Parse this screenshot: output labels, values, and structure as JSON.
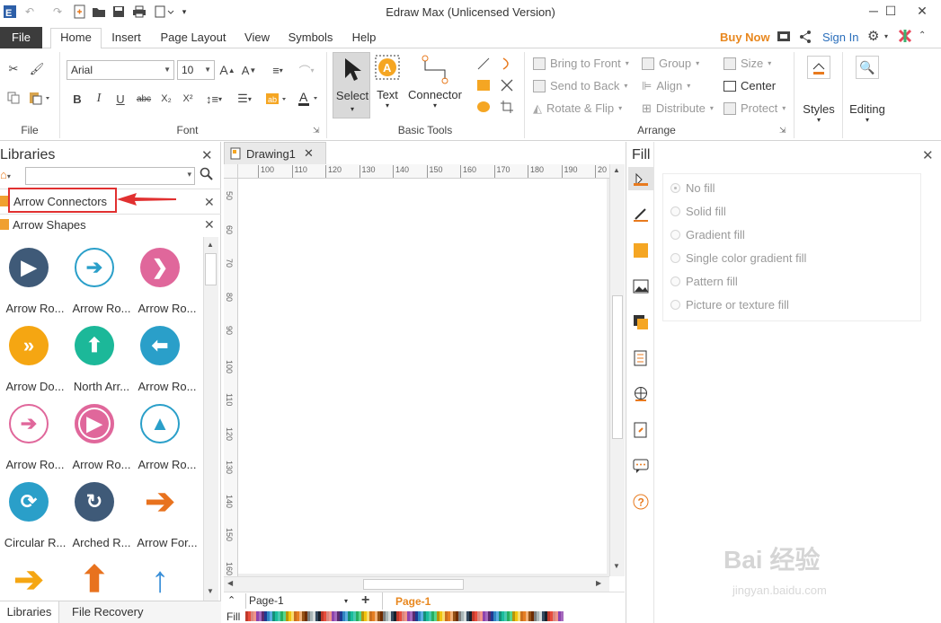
{
  "window": {
    "title": "Edraw Max (Unlicensed Version)",
    "minimize": "─",
    "maximize": "☐",
    "close": "✕"
  },
  "menu": {
    "tabs": [
      "File",
      "Home",
      "Insert",
      "Page Layout",
      "View",
      "Symbols",
      "Help"
    ],
    "buy_now": "Buy Now",
    "sign_in": "Sign In"
  },
  "ribbon": {
    "groups": {
      "file": "File",
      "font": "Font",
      "basic_tools": "Basic Tools",
      "arrange": "Arrange"
    },
    "font_name": "Arial",
    "font_size": "10",
    "select_label": "Select",
    "text_label": "Text",
    "connector_label": "Connector",
    "bring_to_front": "Bring to Front",
    "send_to_back": "Send to Back",
    "rotate_flip": "Rotate & Flip",
    "group": "Group",
    "align": "Align",
    "distribute": "Distribute",
    "size": "Size",
    "center": "Center",
    "protect": "Protect",
    "styles": "Styles",
    "editing": "Editing",
    "format_buttons": [
      "B",
      "I",
      "U",
      "abc",
      "X₂",
      "X²"
    ]
  },
  "libraries": {
    "title": "Libraries",
    "search_placeholder": "",
    "rows": [
      "Arrow Connectors",
      "Arrow Shapes"
    ],
    "shapes": [
      {
        "label": "Arrow Ro...",
        "color": "#3f5a78",
        "glyph": "▶",
        "style": "solid"
      },
      {
        "label": "Arrow Ro...",
        "color": "#2a9fc9",
        "glyph": "➔",
        "style": "ring"
      },
      {
        "label": "Arrow Ro...",
        "color": "#e0679b",
        "glyph": "❯",
        "style": "solid"
      },
      {
        "label": "Arrow Do...",
        "color": "#f5a612",
        "glyph": "»",
        "style": "solid"
      },
      {
        "label": "North Arr...",
        "color": "#1cb899",
        "glyph": "⬆",
        "style": "solid"
      },
      {
        "label": "Arrow Ro...",
        "color": "#2a9fc9",
        "glyph": "⬅",
        "style": "solid"
      },
      {
        "label": "Arrow Ro...",
        "color": "#e0679b",
        "glyph": "➔",
        "style": "ring"
      },
      {
        "label": "Arrow Ro...",
        "color": "#e0679b",
        "glyph": "▶",
        "style": "solid-ring"
      },
      {
        "label": "Arrow Ro...",
        "color": "#2a9fc9",
        "glyph": "▲",
        "style": "ring"
      },
      {
        "label": "Circular R...",
        "color": "#2a9fc9",
        "glyph": "⟳",
        "style": "solid"
      },
      {
        "label": "Arched R...",
        "color": "#3f5a78",
        "glyph": "↻",
        "style": "solid"
      },
      {
        "label": "Arrow For...",
        "color": "#e8721e",
        "glyph": "➔",
        "style": "bare"
      },
      {
        "label": "",
        "color": "#f5a612",
        "glyph": "➔",
        "style": "bare"
      },
      {
        "label": "",
        "color": "#e8721e",
        "glyph": "⬆",
        "style": "bare"
      },
      {
        "label": "",
        "color": "#3a8fd8",
        "glyph": "↑",
        "style": "bare"
      }
    ],
    "bottom_tabs": [
      "Libraries",
      "File Recovery"
    ]
  },
  "document": {
    "tab": "Drawing1",
    "ruler_h": [
      "100",
      "110",
      "120",
      "130",
      "140",
      "150",
      "160",
      "170",
      "180",
      "190",
      "20"
    ],
    "ruler_v": [
      "50",
      "60",
      "70",
      "80",
      "90",
      "100",
      "110",
      "120",
      "130",
      "140",
      "150",
      "160"
    ],
    "page_select": "Page-1",
    "page_tab": "Page-1",
    "fill_label": "Fill"
  },
  "fill_panel": {
    "title": "Fill",
    "options": [
      "No fill",
      "Solid fill",
      "Gradient fill",
      "Single color gradient fill",
      "Pattern fill",
      "Picture or texture fill"
    ],
    "selected": "No fill"
  },
  "watermark": {
    "main": "Bai 经验",
    "sub": "jingyan.baidu.com"
  },
  "colors": {
    "accent": "#e8871e",
    "link": "#2a6ebb",
    "highlight": "#e13030"
  }
}
